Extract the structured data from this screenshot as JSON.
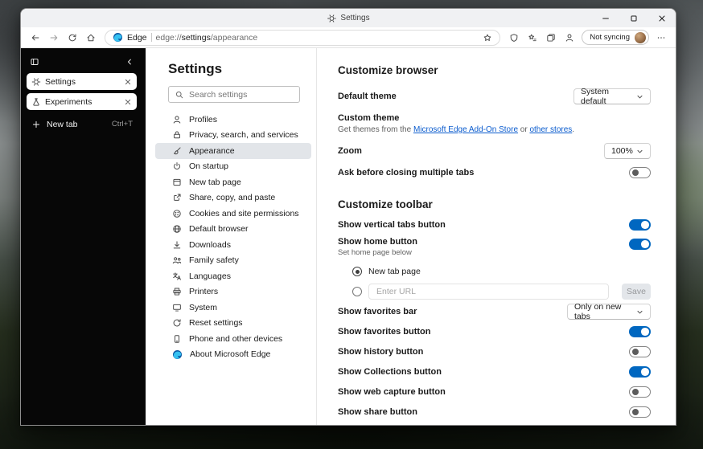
{
  "colors": {
    "accent": "#0067c0",
    "link": "#0b5cce"
  },
  "titlebar": {
    "tab_title": "Settings"
  },
  "toolbar": {
    "browser_name": "Edge",
    "url_scheme": "edge://",
    "url_host": "settings",
    "url_path": "/appearance",
    "profile_label": "Not syncing"
  },
  "vertical_tabs": {
    "tabs": [
      {
        "label": "Settings",
        "icon": "gear-icon",
        "active": true
      },
      {
        "label": "Experiments",
        "icon": "beaker-icon",
        "active": false
      }
    ],
    "new_tab": {
      "label": "New tab",
      "shortcut": "Ctrl+T"
    }
  },
  "settings_nav": {
    "title": "Settings",
    "search_placeholder": "Search settings",
    "items": [
      {
        "label": "Profiles",
        "icon": "profile-icon",
        "selected": false
      },
      {
        "label": "Privacy, search, and services",
        "icon": "privacy-icon",
        "selected": false
      },
      {
        "label": "Appearance",
        "icon": "appearance-icon",
        "selected": true
      },
      {
        "label": "On startup",
        "icon": "power-icon",
        "selected": false
      },
      {
        "label": "New tab page",
        "icon": "newtab-icon",
        "selected": false
      },
      {
        "label": "Share, copy, and paste",
        "icon": "share-icon",
        "selected": false
      },
      {
        "label": "Cookies and site permissions",
        "icon": "cookies-icon",
        "selected": false
      },
      {
        "label": "Default browser",
        "icon": "browser-icon",
        "selected": false
      },
      {
        "label": "Downloads",
        "icon": "download-icon",
        "selected": false
      },
      {
        "label": "Family safety",
        "icon": "family-icon",
        "selected": false
      },
      {
        "label": "Languages",
        "icon": "languages-icon",
        "selected": false
      },
      {
        "label": "Printers",
        "icon": "printer-icon",
        "selected": false
      },
      {
        "label": "System",
        "icon": "system-icon",
        "selected": false
      },
      {
        "label": "Reset settings",
        "icon": "reset-icon",
        "selected": false
      },
      {
        "label": "Phone and other devices",
        "icon": "phone-icon",
        "selected": false
      },
      {
        "label": "About Microsoft Edge",
        "icon": "edge-icon",
        "selected": false
      }
    ]
  },
  "content": {
    "customize_browser": {
      "title": "Customize browser",
      "default_theme": {
        "label": "Default theme",
        "value": "System default"
      },
      "custom_theme": {
        "label": "Custom theme",
        "description_prefix": "Get themes from the ",
        "link_store": "Microsoft Edge Add-On Store",
        "description_mid": " or ",
        "link_other": "other stores",
        "description_suffix": "."
      },
      "zoom": {
        "label": "Zoom",
        "value": "100%"
      },
      "ask_before_closing": {
        "label": "Ask before closing multiple tabs",
        "on": false
      }
    },
    "customize_toolbar": {
      "title": "Customize toolbar",
      "rows": [
        {
          "label": "Show vertical tabs button",
          "control": "toggle",
          "on": true
        },
        {
          "label": "Show home button",
          "control": "toggle",
          "on": true,
          "sublabel": "Set home page below",
          "home_options": true
        },
        {
          "label": "Show favorites bar",
          "control": "dropdown",
          "value": "Only on new tabs"
        },
        {
          "label": "Show favorites button",
          "control": "toggle",
          "on": true
        },
        {
          "label": "Show history button",
          "control": "toggle",
          "on": false
        },
        {
          "label": "Show Collections button",
          "control": "toggle",
          "on": true
        },
        {
          "label": "Show web capture button",
          "control": "toggle",
          "on": false
        },
        {
          "label": "Show share button",
          "control": "toggle",
          "on": false
        }
      ],
      "home_page_options": {
        "new_tab_radio_label": "New tab page",
        "url_placeholder": "Enter URL",
        "save_label": "Save"
      }
    }
  }
}
